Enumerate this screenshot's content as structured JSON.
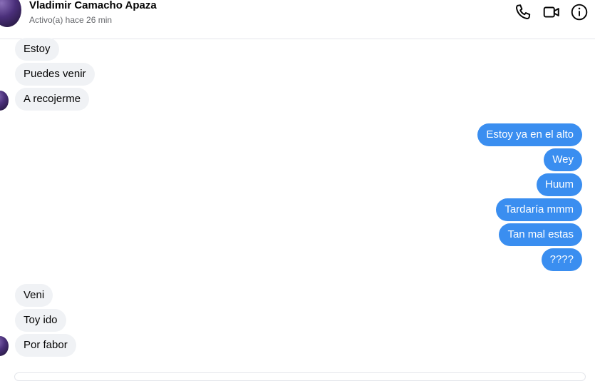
{
  "header": {
    "name": "Vladimir Camacho Apaza",
    "status": "Activo(a) hace 26 min",
    "icons": [
      "phone-icon",
      "video-camera-icon",
      "info-icon"
    ]
  },
  "messages": {
    "group1": [
      "Estoy",
      "Puedes venir",
      "A recojerme"
    ],
    "group2": [
      "Estoy ya en el alto",
      "Wey",
      "Huum",
      "Tardaría mmm",
      "Tan mal estas",
      "????"
    ],
    "group3": [
      "Veni",
      "Toy ido",
      "Por fabor"
    ]
  },
  "colors": {
    "outgoing_bubble": "#3a8ef0",
    "incoming_bubble": "#f0f2f5",
    "accent": "#0a7cff"
  }
}
